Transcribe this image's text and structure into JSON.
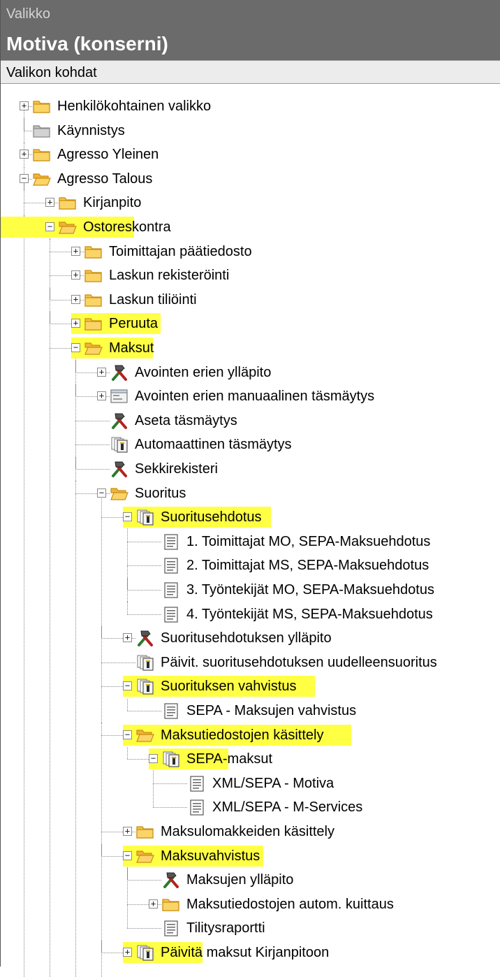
{
  "window": {
    "label": "Valikko",
    "title": "Motiva (konserni)",
    "section_header": "Valikon kohdat"
  },
  "tree": [
    {
      "label": "Henkilökohtainen valikko",
      "level": 0,
      "icon": "folder-icon",
      "expander": "+",
      "highlight": false,
      "cont": []
    },
    {
      "label": "Käynnistys",
      "level": 0,
      "icon": "folder-grey-icon",
      "expander": "",
      "highlight": false,
      "cont": []
    },
    {
      "label": "Agresso Yleinen",
      "level": 0,
      "icon": "folder-icon",
      "expander": "+",
      "highlight": false,
      "cont": []
    },
    {
      "label": "Agresso Talous",
      "level": 0,
      "icon": "folder-open-icon",
      "expander": "-",
      "highlight": false,
      "cont": []
    },
    {
      "label": "Kirjanpito",
      "level": 1,
      "icon": "folder-icon",
      "expander": "+",
      "highlight": false,
      "cont": [
        0
      ]
    },
    {
      "label": "Ostoreskontra",
      "level": 1,
      "icon": "folder-open-icon",
      "expander": "-",
      "highlight": true,
      "cont": [
        0
      ]
    },
    {
      "label": "Toimittajan päätiedosto",
      "level": 2,
      "icon": "folder-icon",
      "expander": "+",
      "highlight": false,
      "cont": [
        0,
        1
      ]
    },
    {
      "label": "Laskun rekisteröinti",
      "level": 2,
      "icon": "folder-icon",
      "expander": "+",
      "highlight": false,
      "cont": [
        0,
        1
      ]
    },
    {
      "label": "Laskun tiliöinti",
      "level": 2,
      "icon": "folder-icon",
      "expander": "+",
      "highlight": false,
      "cont": [
        0,
        1
      ]
    },
    {
      "label": "Peruuta",
      "level": 2,
      "icon": "folder-icon",
      "expander": "+",
      "highlight": true,
      "cont": [
        0,
        1
      ]
    },
    {
      "label": "Maksut",
      "level": 2,
      "icon": "folder-open-icon",
      "expander": "-",
      "highlight": true,
      "cont": [
        0,
        1
      ]
    },
    {
      "label": "Avointen erien ylläpito",
      "level": 3,
      "icon": "tools-icon",
      "expander": "+",
      "highlight": false,
      "cont": [
        0,
        1,
        2
      ]
    },
    {
      "label": "Avointen erien manuaalinen täsmäytys",
      "level": 3,
      "icon": "window-icon",
      "expander": "+",
      "highlight": false,
      "cont": [
        0,
        1,
        2
      ]
    },
    {
      "label": "Aseta täsmäytys",
      "level": 3,
      "icon": "tools-icon",
      "expander": "",
      "highlight": false,
      "cont": [
        0,
        1,
        2
      ]
    },
    {
      "label": "Automaattinen täsmäytys",
      "level": 3,
      "icon": "batch-icon",
      "expander": "",
      "highlight": false,
      "cont": [
        0,
        1,
        2
      ]
    },
    {
      "label": "Sekkirekisteri",
      "level": 3,
      "icon": "tools-icon",
      "expander": "",
      "highlight": false,
      "cont": [
        0,
        1,
        2
      ]
    },
    {
      "label": "Suoritus",
      "level": 3,
      "icon": "folder-open-icon",
      "expander": "-",
      "highlight": false,
      "cont": [
        0,
        1,
        2
      ]
    },
    {
      "label": "Suoritusehdotus",
      "level": 4,
      "icon": "batch-icon",
      "expander": "-",
      "highlight": true,
      "cont": [
        0,
        1,
        2,
        3
      ]
    },
    {
      "label": "1. Toimittajat MO, SEPA-Maksuehdotus",
      "level": 5,
      "icon": "doc-icon",
      "expander": "",
      "highlight": false,
      "cont": [
        0,
        1,
        2,
        3,
        4
      ]
    },
    {
      "label": "2. Toimittajat MS, SEPA-Maksuehdotus",
      "level": 5,
      "icon": "doc-icon",
      "expander": "",
      "highlight": false,
      "cont": [
        0,
        1,
        2,
        3,
        4
      ]
    },
    {
      "label": "3. Työntekijät MO, SEPA-Maksuehdotus",
      "level": 5,
      "icon": "doc-icon",
      "expander": "",
      "highlight": false,
      "cont": [
        0,
        1,
        2,
        3,
        4
      ]
    },
    {
      "label": "4. Työntekijät MS, SEPA-Maksuehdotus",
      "level": 5,
      "icon": "doc-icon",
      "expander": "",
      "highlight": false,
      "cont": [
        0,
        1,
        2,
        3
      ]
    },
    {
      "label": "Suoritusehdotuksen ylläpito",
      "level": 4,
      "icon": "tools-icon",
      "expander": "+",
      "highlight": false,
      "cont": [
        0,
        1,
        2,
        3
      ]
    },
    {
      "label": "Päivit. suoritusehdotuksen uudelleensuoritus",
      "level": 4,
      "icon": "batch-icon",
      "expander": "",
      "highlight": false,
      "cont": [
        0,
        1,
        2,
        3
      ]
    },
    {
      "label": "Suorituksen vahvistus",
      "level": 4,
      "icon": "batch-icon",
      "expander": "-",
      "highlight": true,
      "cont": [
        0,
        1,
        2,
        3
      ]
    },
    {
      "label": "SEPA - Maksujen vahvistus",
      "level": 5,
      "icon": "doc-icon",
      "expander": "",
      "highlight": false,
      "cont": [
        0,
        1,
        2,
        3
      ]
    },
    {
      "label": "Maksutiedostojen käsittely",
      "level": 4,
      "icon": "folder-open-icon",
      "expander": "-",
      "highlight": true,
      "cont": [
        0,
        1,
        2,
        3
      ]
    },
    {
      "label": "SEPA-maksut",
      "level": 5,
      "icon": "batch-icon",
      "expander": "-",
      "highlight": "partial",
      "cont": [
        0,
        1,
        2,
        3
      ]
    },
    {
      "label": "XML/SEPA - Motiva",
      "level": 6,
      "icon": "doc-icon",
      "expander": "",
      "highlight": false,
      "cont": [
        0,
        1,
        2,
        3,
        5
      ]
    },
    {
      "label": "XML/SEPA - M-Services",
      "level": 6,
      "icon": "doc-icon",
      "expander": "",
      "highlight": false,
      "cont": [
        0,
        1,
        2,
        3
      ]
    },
    {
      "label": "Maksulomakkeiden käsittely",
      "level": 4,
      "icon": "folder-icon",
      "expander": "+",
      "highlight": false,
      "cont": [
        0,
        1,
        2,
        3
      ]
    },
    {
      "label": "Maksuvahvistus",
      "level": 4,
      "icon": "folder-open-icon",
      "expander": "-",
      "highlight": true,
      "cont": [
        0,
        1,
        2,
        3
      ]
    },
    {
      "label": "Maksujen ylläpito",
      "level": 5,
      "icon": "tools-icon",
      "expander": "",
      "highlight": false,
      "cont": [
        0,
        1,
        2,
        3,
        4
      ]
    },
    {
      "label": "Maksutiedostojen autom. kuittaus",
      "level": 5,
      "icon": "folder-icon",
      "expander": "+",
      "highlight": false,
      "cont": [
        0,
        1,
        2,
        3,
        4
      ]
    },
    {
      "label": "Tilitysraportti",
      "level": 5,
      "icon": "doc-icon",
      "expander": "",
      "highlight": false,
      "cont": [
        0,
        1,
        2,
        3
      ]
    },
    {
      "label": "Päivitä maksut Kirjanpitoon",
      "level": 4,
      "icon": "batch-icon",
      "expander": "+",
      "highlight": "partial",
      "cont": [
        0,
        1,
        2,
        3
      ]
    }
  ]
}
